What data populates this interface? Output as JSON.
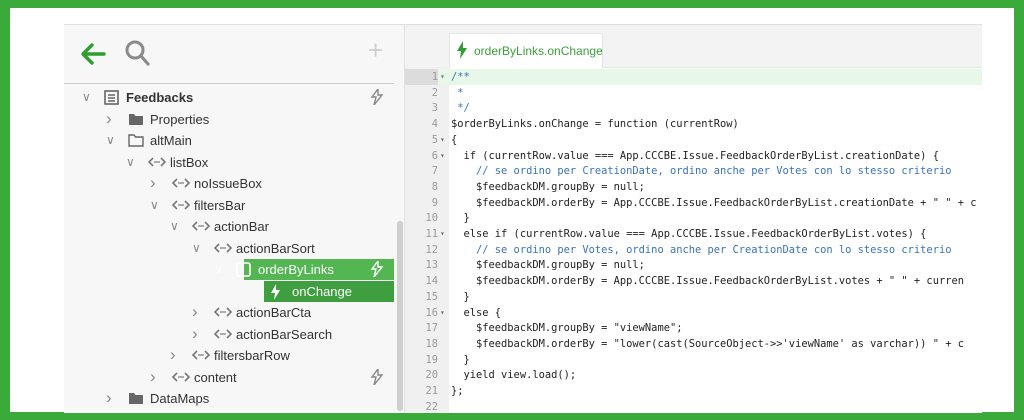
{
  "toolbar": {
    "back_icon": "arrow-left-icon",
    "search_icon": "search-icon",
    "add_label": "+"
  },
  "tree": [
    {
      "label": "Feedbacks",
      "chev": "⌄",
      "icon": "list-icon",
      "bold": true,
      "lightning": true
    },
    {
      "label": "Properties",
      "chev": "›",
      "icon": "folder-icon"
    },
    {
      "label": "altMain",
      "chev": "⌄",
      "icon": "folder-open-icon"
    },
    {
      "label": "listBox",
      "chev": "⌄",
      "icon": "code-icon"
    },
    {
      "label": "noIssueBox",
      "chev": "›",
      "icon": "code-icon"
    },
    {
      "label": "filtersBar",
      "chev": "⌄",
      "icon": "code-icon"
    },
    {
      "label": "actionBar",
      "chev": "⌄",
      "icon": "code-icon"
    },
    {
      "label": "actionBarSort",
      "chev": "⌄",
      "icon": "code-icon"
    },
    {
      "label": "orderByLinks",
      "chev": "⌄",
      "icon": "checkbox-icon",
      "lightning": true
    },
    {
      "label": "onChange",
      "icon": "lightning-icon"
    },
    {
      "label": "actionBarCta",
      "chev": "›",
      "icon": "code-icon"
    },
    {
      "label": "actionBarSearch",
      "chev": "›",
      "icon": "code-icon"
    },
    {
      "label": "filtersbarRow",
      "chev": "›",
      "icon": "code-icon"
    },
    {
      "label": "content",
      "chev": "›",
      "icon": "code-icon",
      "lightning": true
    },
    {
      "label": "DataMaps",
      "chev": "›",
      "icon": "folder-icon"
    }
  ],
  "editor": {
    "tab_title": "orderByLinks.onChange",
    "lines": [
      "/**",
      " *",
      " */",
      "$orderByLinks.onChange = function (currentRow)",
      "{",
      "  if (currentRow.value === App.CCCBE.Issue.FeedbackOrderByList.creationDate) {",
      "    // se ordino per CreationDate, ordino anche per Votes con lo stesso criterio",
      "    $feedbackDM.groupBy = null;",
      "    $feedbackDM.orderBy = App.CCCBE.Issue.FeedbackOrderByList.creationDate + \" \" + c",
      "  }",
      "  else if (currentRow.value === App.CCCBE.Issue.FeedbackOrderByList.votes) {",
      "    // se ordino per Votes, ordino anche per CreationDate con lo stesso criterio",
      "    $feedbackDM.groupBy = null;",
      "    $feedbackDM.orderBy = App.CCCBE.Issue.FeedbackOrderByList.votes + \" \" + curren",
      "  }",
      "  else {",
      "    $feedbackDM.groupBy = \"viewName\";",
      "    $feedbackDM.orderBy = \"lower(cast(SourceObject->>'viewName' as varchar)) \" + c",
      "  }",
      "  yield view.load();",
      "};",
      ""
    ]
  }
}
